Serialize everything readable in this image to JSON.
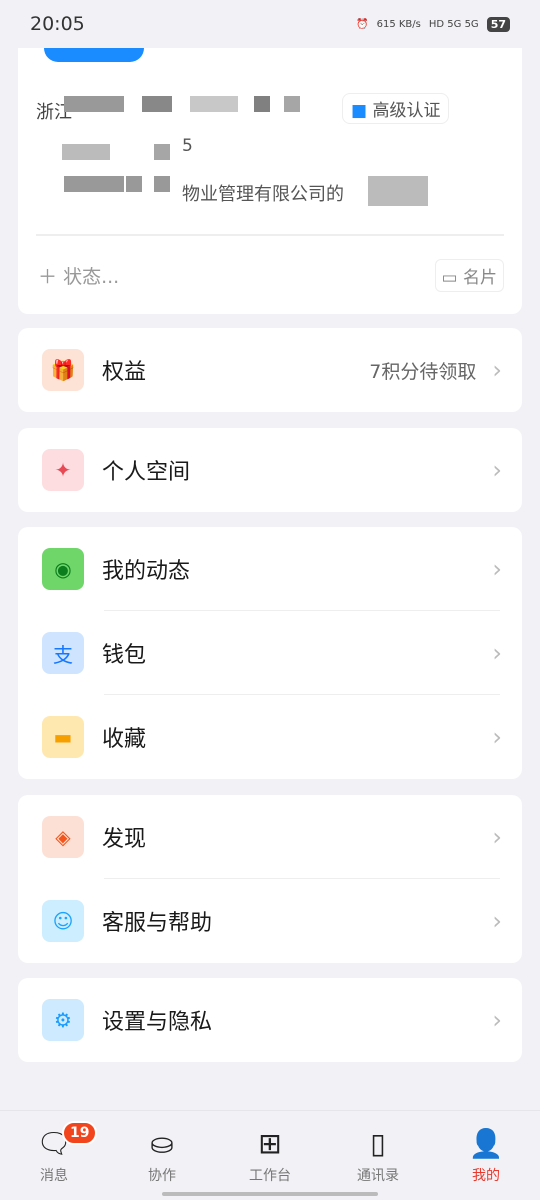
{
  "status": {
    "time": "20:05",
    "speed": "615 KB/s",
    "network": "HD 5G 5G",
    "battery": "57"
  },
  "profile": {
    "location_partial": "浙江",
    "verified": "高级认证",
    "badge_partial": "5",
    "company_partial": "物业管理有限公司的",
    "status_placeholder": "状态...",
    "card_button": "名片"
  },
  "menu": {
    "rights": {
      "label": "权益",
      "extra": "7积分待领取",
      "icon": "gift-icon",
      "color": "#f25a1d"
    },
    "space": {
      "label": "个人空间",
      "icon": "sparkle-icon",
      "color": "#e84a55"
    },
    "group2": [
      {
        "label": "我的动态",
        "icon": "eye-icon",
        "color": "#22b83a"
      },
      {
        "label": "钱包",
        "icon": "alipay-icon",
        "color": "#1677ff"
      },
      {
        "label": "收藏",
        "icon": "folder-icon",
        "color": "#f5a000"
      }
    ],
    "group3": [
      {
        "label": "发现",
        "icon": "compass-icon",
        "color": "#f2561d"
      },
      {
        "label": "客服与帮助",
        "icon": "headset-icon",
        "color": "#1aa3ff"
      }
    ],
    "settings": {
      "label": "设置与隐私",
      "icon": "gear-icon",
      "color": "#1a9cff"
    }
  },
  "tabs": [
    {
      "label": "消息",
      "icon": "chat-icon",
      "badge": "19"
    },
    {
      "label": "协作",
      "icon": "briefcase-cloud-icon"
    },
    {
      "label": "工作台",
      "icon": "grid-icon"
    },
    {
      "label": "通讯录",
      "icon": "contacts-icon"
    },
    {
      "label": "我的",
      "icon": "user-icon",
      "active": true
    }
  ]
}
